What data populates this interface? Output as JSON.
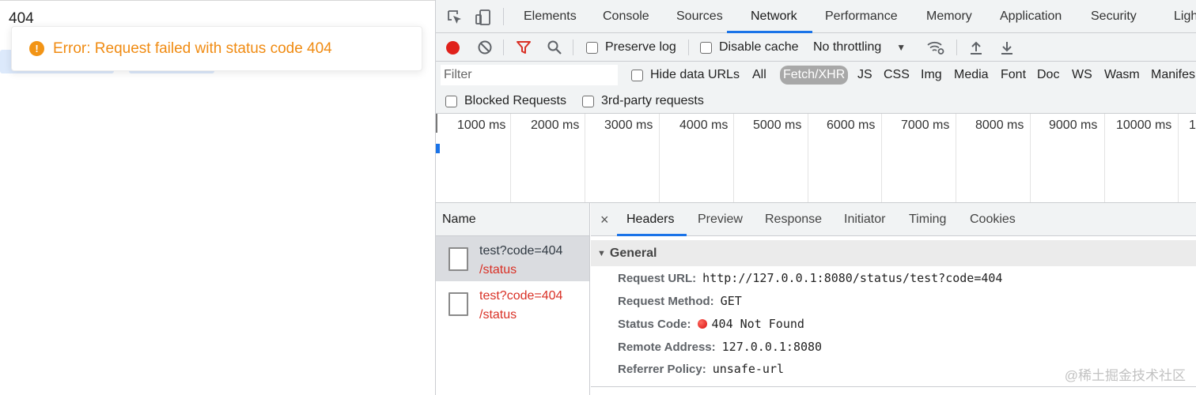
{
  "page": {
    "heading": "404",
    "toast": {
      "icon": "!",
      "message": "Error: Request failed with status code 404",
      "color": "#f08b12"
    }
  },
  "devtools": {
    "tabs": [
      "Elements",
      "Console",
      "Sources",
      "Network",
      "Performance",
      "Memory",
      "Application",
      "Security",
      "Ligh"
    ],
    "active_tab": "Network",
    "toolbar": {
      "preserve_log": "Preserve log",
      "disable_cache": "Disable cache",
      "throttling": "No throttling"
    },
    "filter": {
      "placeholder": "Filter",
      "hide_data_urls": "Hide data URLs",
      "types": [
        "All",
        "Fetch/XHR",
        "JS",
        "CSS",
        "Img",
        "Media",
        "Font",
        "Doc",
        "WS",
        "Wasm",
        "Manifes"
      ],
      "active_type": "Fetch/XHR",
      "blocked_requests": "Blocked Requests",
      "third_party": "3rd-party requests"
    },
    "overview_ticks": [
      "1000 ms",
      "2000 ms",
      "3000 ms",
      "4000 ms",
      "5000 ms",
      "6000 ms",
      "7000 ms",
      "8000 ms",
      "9000 ms",
      "10000 ms",
      "1"
    ],
    "request_list": {
      "header": "Name",
      "rows": [
        {
          "name": "test?code=404",
          "path": "/status",
          "selected": true
        },
        {
          "name": "test?code=404",
          "path": "/status",
          "selected": false
        }
      ]
    },
    "details": {
      "close": "×",
      "tabs": [
        "Headers",
        "Preview",
        "Response",
        "Initiator",
        "Timing",
        "Cookies"
      ],
      "active_tab": "Headers",
      "section": "General",
      "rows": [
        {
          "key": "Request URL:",
          "value": "http://127.0.0.1:8080/status/test?code=404"
        },
        {
          "key": "Request Method:",
          "value": "GET"
        },
        {
          "key": "Status Code:",
          "value": "404 Not Found"
        },
        {
          "key": "Remote Address:",
          "value": "127.0.0.1:8080"
        },
        {
          "key": "Referrer Policy:",
          "value": "unsafe-url"
        }
      ]
    },
    "watermark": "@稀土掘金技术社区",
    "colors": {
      "accent": "#1a73e8",
      "error": "#d93025",
      "record": "#e0211b"
    }
  }
}
